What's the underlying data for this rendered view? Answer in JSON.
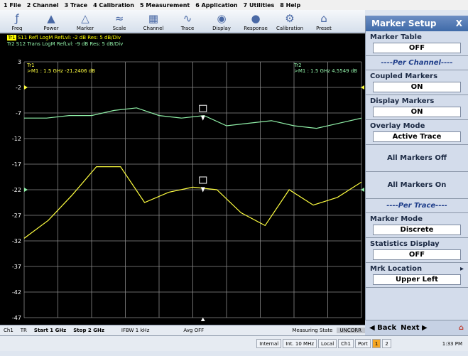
{
  "menu": [
    "1 File",
    "2 Channel",
    "3 Trace",
    "4 Calibration",
    "5 Measurement",
    "6 Application",
    "7 Utilities",
    "8 Help"
  ],
  "toolbar": [
    {
      "label": "Freq",
      "icon": "freq-icon"
    },
    {
      "label": "Power",
      "icon": "power-icon"
    },
    {
      "label": "Marker",
      "icon": "marker-icon"
    },
    {
      "label": "Scale",
      "icon": "scale-icon"
    },
    {
      "label": "Channel",
      "icon": "channel-icon"
    },
    {
      "label": "Trace",
      "icon": "trace-icon"
    },
    {
      "label": "Display",
      "icon": "display-icon"
    },
    {
      "label": "Response",
      "icon": "response-icon"
    },
    {
      "label": "Calibration",
      "icon": "calibration-icon"
    },
    {
      "label": "Preset",
      "icon": "preset-icon"
    }
  ],
  "legend": {
    "tr1_tag": "Tr1",
    "tr1_text": "S11 Refl LogM RefLvl: -2 dB Res: 5 dB/Div",
    "tr2_text": "Tr2  S12 Trans LogM RefLvl: -9  dB Res: 5  dB/Div",
    "tr1_name": "Tr1",
    "tr1_marker": ">M1 : 1.5 GHz -21.2406 dB",
    "tr2_name": "Tr2",
    "tr2_marker": ">M1 : 1.5 GHz 4.5549 dB"
  },
  "chart_data": {
    "type": "line",
    "y_ticks": [
      "3",
      "-2",
      "-7",
      "-12",
      "-17",
      "-22",
      "-27",
      "-32",
      "-37",
      "-42",
      "-47"
    ],
    "ylim": [
      -47,
      3
    ],
    "x": [
      0,
      1,
      2,
      3,
      4,
      5,
      6,
      7,
      8,
      9,
      10
    ],
    "series": [
      {
        "color": "#ffff40",
        "values": [
          -31.5,
          -28,
          -23,
          -17.5,
          -17.5,
          -24.5,
          -22.5,
          -21.5,
          -22,
          -26.5,
          -29,
          -22,
          -25,
          -23.5,
          -20.5
        ],
        "xs": [
          0,
          0.65,
          1.5,
          2.5,
          3,
          4.1,
          5,
          5.6,
          6.3,
          7.2,
          8,
          8.9,
          9.4,
          10
        ]
      },
      {
        "color": "#90f0a8",
        "values": [
          -8,
          -8,
          -7.5,
          -7.5,
          -6.5,
          -6,
          -7.5,
          -8,
          -7.5,
          -9.5,
          -9,
          -8.5,
          -9.5,
          -10,
          -9,
          -8
        ]
      }
    ],
    "grid": true
  },
  "status": {
    "ch": "Ch1",
    "tr": "TR",
    "start": "Start 1 GHz",
    "stop": "Stop 2 GHz",
    "ifbw": "IFBW 1 kHz",
    "avg": "Avg OFF",
    "state": "Measuring State",
    "corr": "UNCORR"
  },
  "bottom": {
    "internal": "Internal",
    "ref": "Int. 10 MHz",
    "local": "Local",
    "ch": "Ch1",
    "port": "Port",
    "p1": "1",
    "p2": "2",
    "time": "1:33 PM"
  },
  "panel": {
    "title": "Marker Setup",
    "close": "X",
    "marker_table_label": "Marker Table",
    "marker_table_value": "OFF",
    "per_channel": "----Per Channel----",
    "coupled_label": "Coupled Markers",
    "coupled_value": "ON",
    "display_label": "Display Markers",
    "display_value": "ON",
    "overlay_label": "Overlay Mode",
    "overlay_value": "Active Trace",
    "all_off": "All Markers Off",
    "all_on": "All Markers On",
    "per_trace": "----Per Trace----",
    "mode_label": "Marker Mode",
    "mode_value": "Discrete",
    "stats_label": "Statistics Display",
    "stats_value": "OFF",
    "loc_label": "Mrk Location",
    "loc_value": "Upper Left",
    "back": "Back",
    "next": "Next"
  }
}
